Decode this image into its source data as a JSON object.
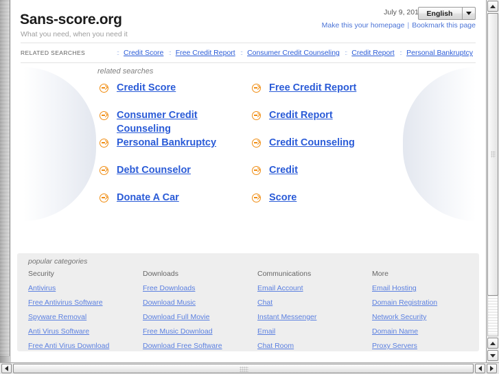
{
  "header": {
    "site_title": "Sans-score.org",
    "tagline": "What you need, when you need it",
    "date": "July 9, 2011",
    "language": "English",
    "make_homepage": "Make this your homepage",
    "separator": "|",
    "bookmark": "Bookmark this page"
  },
  "related_strip": {
    "label": "RELATED SEARCHES",
    "dots": "::",
    "items": [
      "Credit Score",
      "Free Credit Report",
      "Consumer Credit Counseling",
      "Credit Report",
      "Personal Bankruptcy"
    ]
  },
  "main": {
    "heading": "related searches",
    "column_left": [
      "Credit Score",
      "Consumer Credit Counseling",
      "Personal Bankruptcy",
      "Debt Counselor",
      "Donate A Car"
    ],
    "column_right": [
      "Free Credit Report",
      "Credit Report",
      "Credit Counseling",
      "Credit",
      "Score"
    ]
  },
  "popular": {
    "title": "popular categories",
    "columns": [
      {
        "heading": "Security",
        "links": [
          "Antivirus",
          "Free Antivirus Software",
          "Spyware Removal",
          "Anti Virus Software",
          "Free Anti Virus Download"
        ]
      },
      {
        "heading": "Downloads",
        "links": [
          "Free Downloads",
          "Download Music",
          "Download Full Movie",
          "Free Music Download",
          "Download Free Software"
        ]
      },
      {
        "heading": "Communications",
        "links": [
          "Email Account",
          "Chat",
          "Instant Messenger",
          "Email",
          "Chat Room"
        ]
      },
      {
        "heading": "More",
        "links": [
          "Email Hosting",
          "Domain Registration",
          "Network Security",
          "Domain Name",
          "Proxy Servers"
        ]
      }
    ]
  },
  "colors": {
    "link_blue": "#2a5bd7",
    "footer_link_blue": "#5a7fe0",
    "arrow_orange": "#f08c10",
    "panel_gray": "#eeeeee"
  }
}
